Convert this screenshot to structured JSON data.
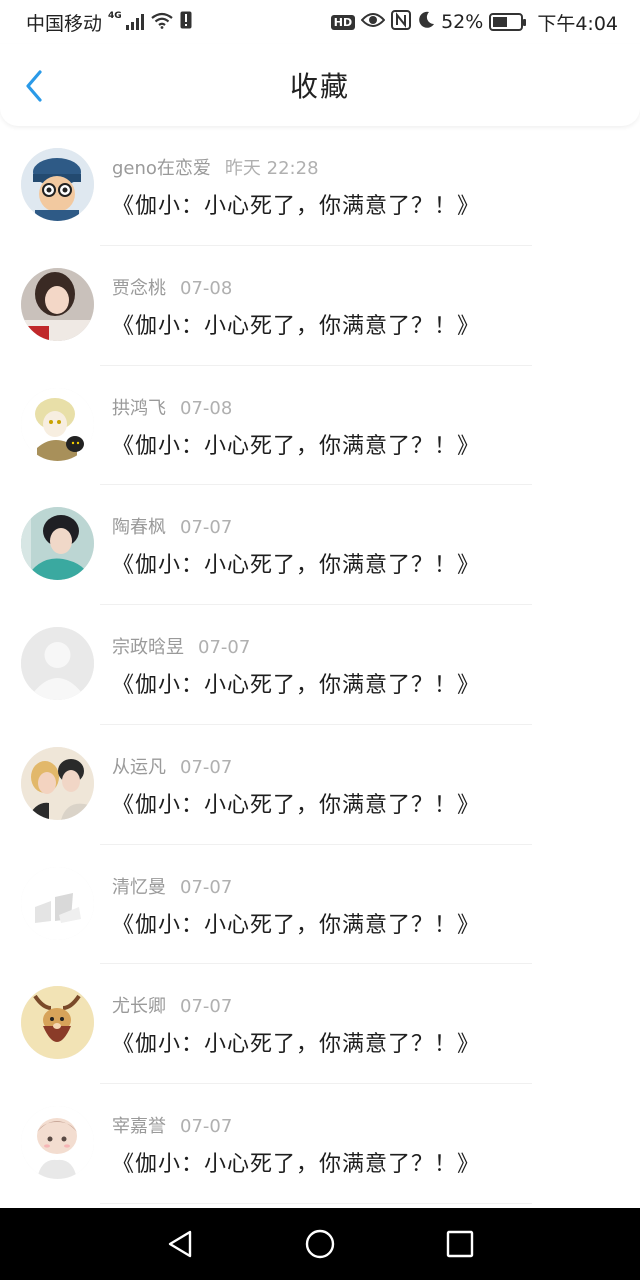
{
  "status_bar": {
    "carrier": "中国移动",
    "network": "4G",
    "battery_percent": "52%",
    "battery_level": 0.52,
    "time": "下午4:04",
    "icons": [
      "signal-icon",
      "wifi-icon",
      "sim-alert-icon",
      "hd-icon",
      "eye-icon",
      "nfc-icon",
      "moon-icon",
      "battery-icon"
    ]
  },
  "header": {
    "title": "收藏",
    "back_icon": "chevron-left-icon",
    "accent_color": "#2a9ae8"
  },
  "favorites": [
    {
      "name": "geno在恋爱",
      "time": "昨天 22:28",
      "message": "《伽小：小心死了，你满意了？！》",
      "avatar": "cartoon-hat-avatar"
    },
    {
      "name": "贾念桃",
      "time": "07-08",
      "message": "《伽小：小心死了，你满意了？！》",
      "avatar": "girl-photo-avatar"
    },
    {
      "name": "拱鸿飞",
      "time": "07-08",
      "message": "《伽小：小心死了，你满意了？！》",
      "avatar": "anime-cat-avatar"
    },
    {
      "name": "陶春枫",
      "time": "07-07",
      "message": "《伽小：小心死了，你满意了？！》",
      "avatar": "boy-photo-avatar"
    },
    {
      "name": "宗政晗昱",
      "time": "07-07",
      "message": "《伽小：小心死了，你满意了？！》",
      "avatar": "default-avatar"
    },
    {
      "name": "从运凡",
      "time": "07-07",
      "message": "《伽小：小心死了，你满意了？！》",
      "avatar": "couple-photo-avatar"
    },
    {
      "name": "清忆曼",
      "time": "07-07",
      "message": "《伽小：小心死了，你满意了？！》",
      "avatar": "faded-photo-avatar"
    },
    {
      "name": "尤长卿",
      "time": "07-07",
      "message": "《伽小：小心死了，你满意了？！》",
      "avatar": "capricorn-avatar"
    },
    {
      "name": "宰嘉誉",
      "time": "07-07",
      "message": "《伽小：小心死了，你满意了？！》",
      "avatar": "anime-boy-avatar"
    }
  ],
  "nav_bar": {
    "buttons": [
      "back-triangle-icon",
      "home-circle-icon",
      "recents-square-icon"
    ]
  }
}
